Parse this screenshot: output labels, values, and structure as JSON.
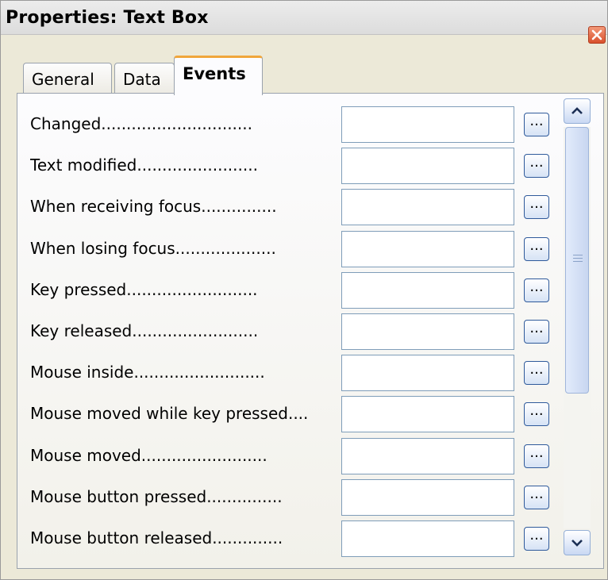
{
  "window": {
    "title": "Properties: Text Box",
    "close_label": ""
  },
  "tabs": [
    {
      "label": "General",
      "active": false
    },
    {
      "label": "Data",
      "active": false
    },
    {
      "label": "Events",
      "active": true
    }
  ],
  "events": {
    "rows": [
      {
        "label": "Changed..............................",
        "value": "",
        "button": "..."
      },
      {
        "label": "Text modified........................",
        "value": "",
        "button": "..."
      },
      {
        "label": "When receiving focus...............",
        "value": "",
        "button": "..."
      },
      {
        "label": "When losing focus....................",
        "value": "",
        "button": "..."
      },
      {
        "label": "Key pressed..........................",
        "value": "",
        "button": "..."
      },
      {
        "label": "Key released.........................",
        "value": "",
        "button": "..."
      },
      {
        "label": "Mouse inside..........................",
        "value": "",
        "button": "..."
      },
      {
        "label": "Mouse moved while key pressed....",
        "value": "",
        "button": "..."
      },
      {
        "label": "Mouse moved.........................",
        "value": "",
        "button": "..."
      },
      {
        "label": "Mouse button pressed...............",
        "value": "",
        "button": "..."
      },
      {
        "label": "Mouse button released..............",
        "value": "",
        "button": "..."
      }
    ]
  },
  "icons": {
    "close": "close-icon",
    "scroll_up": "chevron-up-icon",
    "scroll_down": "chevron-down-icon",
    "grip": "grip-icon"
  },
  "colors": {
    "active_tab_accent": "#f0a63b",
    "close_button": "#d9502c",
    "field_border": "#7f9db9"
  }
}
